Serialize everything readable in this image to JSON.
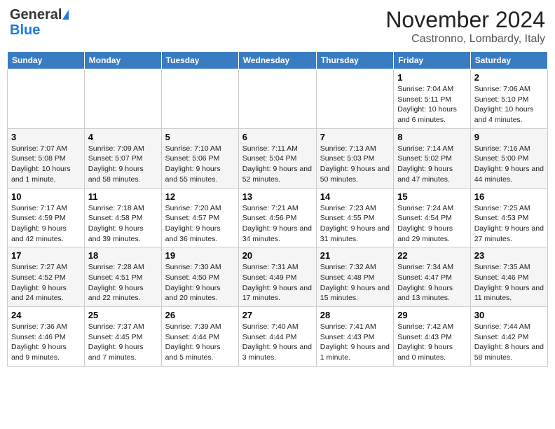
{
  "header": {
    "logo_general": "General",
    "logo_blue": "Blue",
    "month_title": "November 2024",
    "location": "Castronno, Lombardy, Italy"
  },
  "days_of_week": [
    "Sunday",
    "Monday",
    "Tuesday",
    "Wednesday",
    "Thursday",
    "Friday",
    "Saturday"
  ],
  "weeks": [
    [
      {
        "day": "",
        "info": ""
      },
      {
        "day": "",
        "info": ""
      },
      {
        "day": "",
        "info": ""
      },
      {
        "day": "",
        "info": ""
      },
      {
        "day": "",
        "info": ""
      },
      {
        "day": "1",
        "info": "Sunrise: 7:04 AM\nSunset: 5:11 PM\nDaylight: 10 hours and 6 minutes."
      },
      {
        "day": "2",
        "info": "Sunrise: 7:06 AM\nSunset: 5:10 PM\nDaylight: 10 hours and 4 minutes."
      }
    ],
    [
      {
        "day": "3",
        "info": "Sunrise: 7:07 AM\nSunset: 5:08 PM\nDaylight: 10 hours and 1 minute."
      },
      {
        "day": "4",
        "info": "Sunrise: 7:09 AM\nSunset: 5:07 PM\nDaylight: 9 hours and 58 minutes."
      },
      {
        "day": "5",
        "info": "Sunrise: 7:10 AM\nSunset: 5:06 PM\nDaylight: 9 hours and 55 minutes."
      },
      {
        "day": "6",
        "info": "Sunrise: 7:11 AM\nSunset: 5:04 PM\nDaylight: 9 hours and 52 minutes."
      },
      {
        "day": "7",
        "info": "Sunrise: 7:13 AM\nSunset: 5:03 PM\nDaylight: 9 hours and 50 minutes."
      },
      {
        "day": "8",
        "info": "Sunrise: 7:14 AM\nSunset: 5:02 PM\nDaylight: 9 hours and 47 minutes."
      },
      {
        "day": "9",
        "info": "Sunrise: 7:16 AM\nSunset: 5:00 PM\nDaylight: 9 hours and 44 minutes."
      }
    ],
    [
      {
        "day": "10",
        "info": "Sunrise: 7:17 AM\nSunset: 4:59 PM\nDaylight: 9 hours and 42 minutes."
      },
      {
        "day": "11",
        "info": "Sunrise: 7:18 AM\nSunset: 4:58 PM\nDaylight: 9 hours and 39 minutes."
      },
      {
        "day": "12",
        "info": "Sunrise: 7:20 AM\nSunset: 4:57 PM\nDaylight: 9 hours and 36 minutes."
      },
      {
        "day": "13",
        "info": "Sunrise: 7:21 AM\nSunset: 4:56 PM\nDaylight: 9 hours and 34 minutes."
      },
      {
        "day": "14",
        "info": "Sunrise: 7:23 AM\nSunset: 4:55 PM\nDaylight: 9 hours and 31 minutes."
      },
      {
        "day": "15",
        "info": "Sunrise: 7:24 AM\nSunset: 4:54 PM\nDaylight: 9 hours and 29 minutes."
      },
      {
        "day": "16",
        "info": "Sunrise: 7:25 AM\nSunset: 4:53 PM\nDaylight: 9 hours and 27 minutes."
      }
    ],
    [
      {
        "day": "17",
        "info": "Sunrise: 7:27 AM\nSunset: 4:52 PM\nDaylight: 9 hours and 24 minutes."
      },
      {
        "day": "18",
        "info": "Sunrise: 7:28 AM\nSunset: 4:51 PM\nDaylight: 9 hours and 22 minutes."
      },
      {
        "day": "19",
        "info": "Sunrise: 7:30 AM\nSunset: 4:50 PM\nDaylight: 9 hours and 20 minutes."
      },
      {
        "day": "20",
        "info": "Sunrise: 7:31 AM\nSunset: 4:49 PM\nDaylight: 9 hours and 17 minutes."
      },
      {
        "day": "21",
        "info": "Sunrise: 7:32 AM\nSunset: 4:48 PM\nDaylight: 9 hours and 15 minutes."
      },
      {
        "day": "22",
        "info": "Sunrise: 7:34 AM\nSunset: 4:47 PM\nDaylight: 9 hours and 13 minutes."
      },
      {
        "day": "23",
        "info": "Sunrise: 7:35 AM\nSunset: 4:46 PM\nDaylight: 9 hours and 11 minutes."
      }
    ],
    [
      {
        "day": "24",
        "info": "Sunrise: 7:36 AM\nSunset: 4:46 PM\nDaylight: 9 hours and 9 minutes."
      },
      {
        "day": "25",
        "info": "Sunrise: 7:37 AM\nSunset: 4:45 PM\nDaylight: 9 hours and 7 minutes."
      },
      {
        "day": "26",
        "info": "Sunrise: 7:39 AM\nSunset: 4:44 PM\nDaylight: 9 hours and 5 minutes."
      },
      {
        "day": "27",
        "info": "Sunrise: 7:40 AM\nSunset: 4:44 PM\nDaylight: 9 hours and 3 minutes."
      },
      {
        "day": "28",
        "info": "Sunrise: 7:41 AM\nSunset: 4:43 PM\nDaylight: 9 hours and 1 minute."
      },
      {
        "day": "29",
        "info": "Sunrise: 7:42 AM\nSunset: 4:43 PM\nDaylight: 9 hours and 0 minutes."
      },
      {
        "day": "30",
        "info": "Sunrise: 7:44 AM\nSunset: 4:42 PM\nDaylight: 8 hours and 58 minutes."
      }
    ]
  ]
}
